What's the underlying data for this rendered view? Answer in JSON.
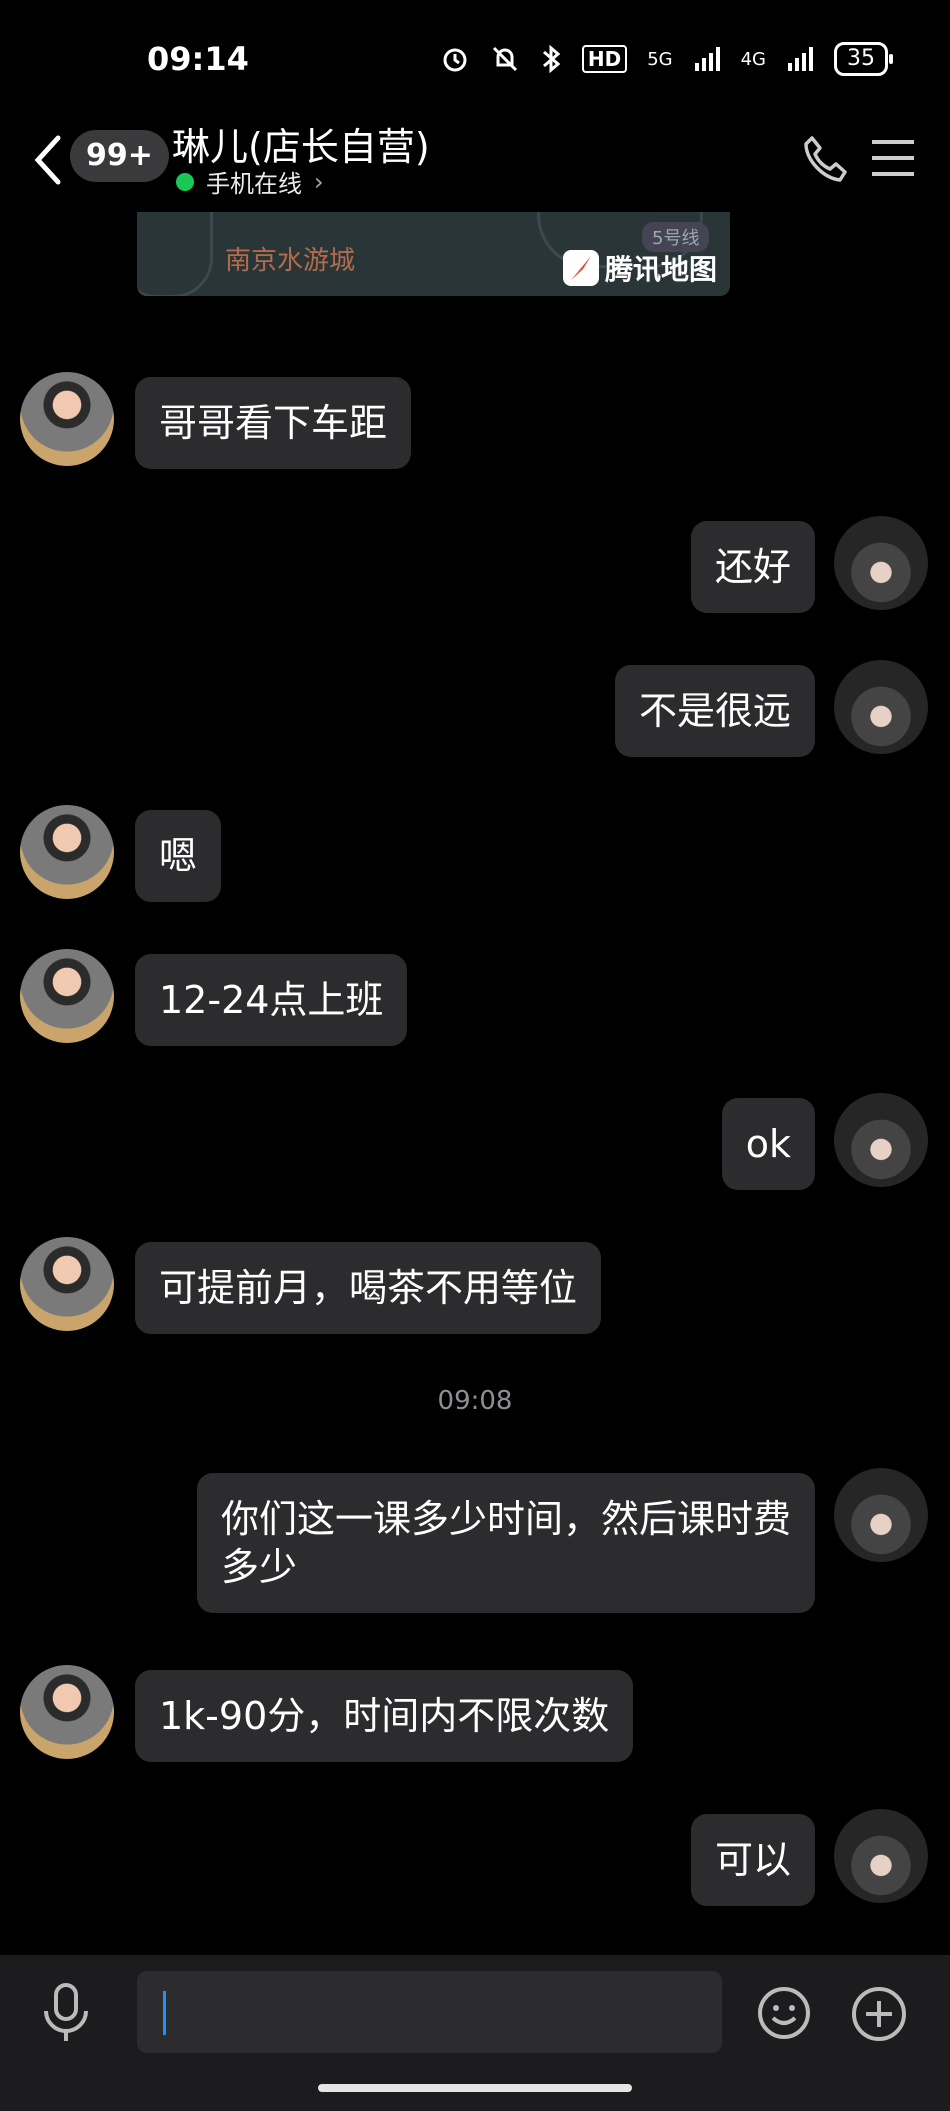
{
  "status_bar": {
    "time": "09:14",
    "network_1": "5G",
    "network_2": "4G",
    "hd": "HD",
    "battery": "35"
  },
  "header": {
    "unread_badge": "99+",
    "title": "琳儿(店长自营)",
    "online_status": "手机在线",
    "online_chevron": "›"
  },
  "map_card": {
    "place": "南京水游城",
    "line": "5号线",
    "brand": "腾讯地图"
  },
  "messages": [
    {
      "side": "left",
      "text": "哥哥看下车距"
    },
    {
      "side": "right",
      "text": "还好"
    },
    {
      "side": "right",
      "text": "不是很远"
    },
    {
      "side": "left",
      "text": "嗯"
    },
    {
      "side": "left",
      "text": "12-24点上班"
    },
    {
      "side": "right",
      "text": "ok"
    },
    {
      "side": "left",
      "text": "可提前月，喝茶不用等位"
    },
    {
      "side": "timestamp",
      "text": "09:08"
    },
    {
      "side": "right",
      "text": "你们这一课多少时间，然后课时费\n多少"
    },
    {
      "side": "left",
      "text": "1k-90分，时间内不限次数"
    },
    {
      "side": "right",
      "text": "可以"
    }
  ],
  "input": {
    "placeholder": ""
  },
  "colors": {
    "background": "#000000",
    "bubble": "#2c2c2e",
    "online_dot": "#18c957",
    "cursor": "#1e90ff"
  }
}
